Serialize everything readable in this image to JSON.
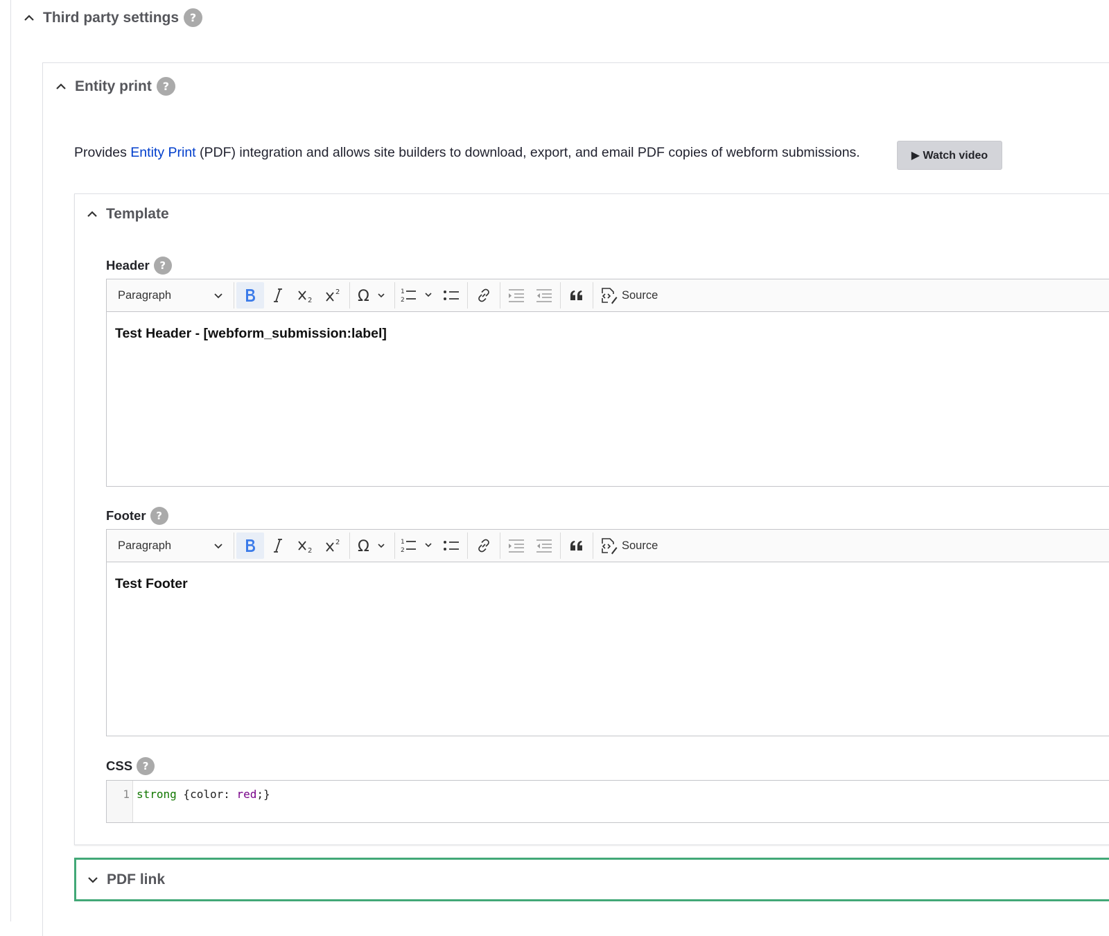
{
  "third_party": {
    "title": "Third party settings",
    "help": "?"
  },
  "entity_print": {
    "title": "Entity print",
    "help": "?",
    "desc_prefix": "Provides ",
    "desc_link": "Entity Print",
    "desc_suffix": " (PDF) integration and allows site builders to download, export, and email PDF copies of webform submissions.",
    "watch_video": "▶ Watch video"
  },
  "template": {
    "title": "Template",
    "header": {
      "label": "Header",
      "help": "?",
      "format": "Paragraph",
      "source_label": "Source",
      "content": "Test Header - [webform_submission:label]"
    },
    "footer": {
      "label": "Footer",
      "help": "?",
      "format": "Paragraph",
      "source_label": "Source",
      "content": "Test Footer"
    },
    "css": {
      "label": "CSS",
      "help": "?",
      "line_number": "1",
      "selector": "strong",
      "brace_open": " {color: ",
      "value": "red",
      "brace_close": ";}"
    }
  },
  "pdf_link": {
    "title": "PDF link"
  },
  "colors": {
    "link": "#003ecc",
    "accent_border": "#42a877",
    "bold_active": "#3b7be9",
    "help_bg": "#aaaaaa"
  }
}
